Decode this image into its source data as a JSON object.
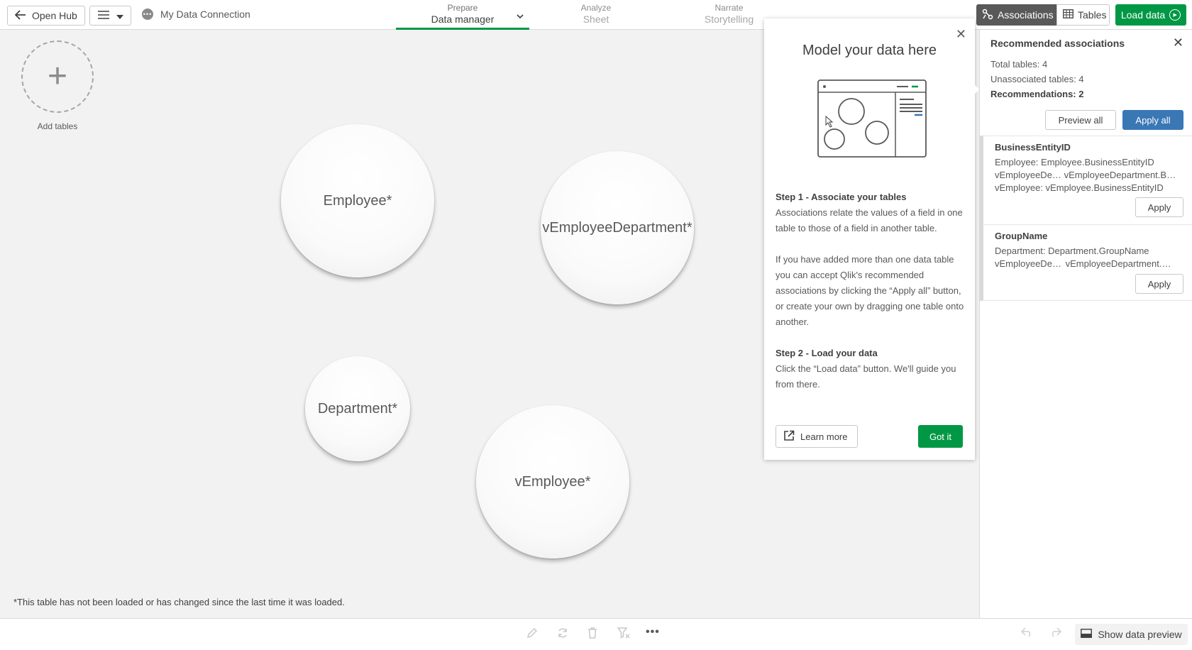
{
  "topbar": {
    "open_hub": "Open Hub",
    "connection": "My Data Connection",
    "connection_icon": "•••",
    "tabs": [
      {
        "small": "Prepare",
        "big": "Data manager"
      },
      {
        "small": "Analyze",
        "big": "Sheet"
      },
      {
        "small": "Narrate",
        "big": "Storytelling"
      }
    ],
    "associations": "Associations",
    "tables": "Tables",
    "load_data": "Load data"
  },
  "canvas": {
    "add_tables": "Add tables",
    "bubbles": [
      "Employee*",
      "vEmployeeDepartment*",
      "Department*",
      "vEmployee*"
    ],
    "footnote": "*This table has not been loaded or has changed since the last time it was loaded."
  },
  "popup": {
    "title": "Model your data here",
    "step1_heading": "Step 1 - Associate your tables",
    "step1_text": "Associations relate the values of a field in one table to those of a field in another table.",
    "step1_text2": "If you have added more than one data table you can accept Qlik's recommended associations by clicking the “Apply all” button, or create your own by dragging one table onto another.",
    "step2_heading": "Step 2 - Load your data",
    "step2_text": "Click the “Load data” button. We'll guide you from there.",
    "learn_more": "Learn more",
    "got_it": "Got it"
  },
  "panel": {
    "title": "Recommended associations",
    "total_tables": "Total tables: 4",
    "unassociated_tables": "Unassociated tables: 4",
    "recommendations": "Recommendations: 2",
    "preview_all": "Preview all",
    "apply_all": "Apply all",
    "items": [
      {
        "name": "BusinessEntityID",
        "lines": [
          {
            "table": "Employee:",
            "field": "Employee.BusinessEntityID"
          },
          {
            "table": "vEmployeeDe…",
            "field": "vEmployeeDepartment.B…"
          },
          {
            "table": "vEmployee:",
            "field": "vEmployee.BusinessEntityID"
          }
        ],
        "apply": "Apply"
      },
      {
        "name": "GroupName",
        "lines": [
          {
            "table": "Department:",
            "field": "Department.GroupName"
          },
          {
            "table": "vEmployeeDep…",
            "field": "vEmployeeDepartment.…"
          }
        ],
        "apply": "Apply"
      }
    ]
  },
  "bottombar": {
    "more": "•••",
    "show_data_preview": "Show data preview"
  },
  "colors": {
    "accent_green": "#009845",
    "accent_blue": "#3a77b5",
    "segment_active": "#595959"
  }
}
